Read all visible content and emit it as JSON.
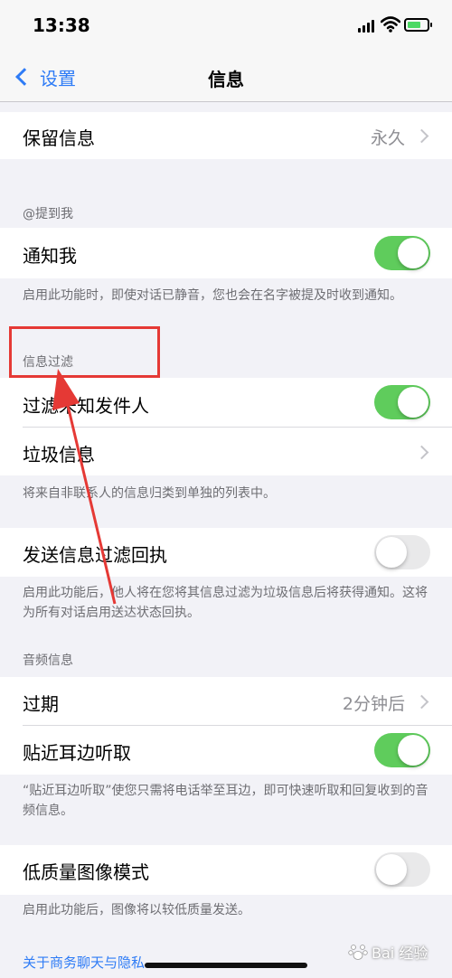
{
  "status_bar": {
    "time": "13:38"
  },
  "nav": {
    "back_label": "设置",
    "title": "信息"
  },
  "keep_messages": {
    "label": "保留信息",
    "value": "永久"
  },
  "mentions": {
    "header": "@提到我",
    "notify_label": "通知我",
    "notify_on": true,
    "footer": "启用此功能时，即使对话已静音，您也会在名字被提及时收到通知。"
  },
  "filtering": {
    "header": "信息过滤",
    "filter_unknown_label": "过滤未知发件人",
    "filter_unknown_on": true,
    "junk_label": "垃圾信息",
    "footer": "将来自非联系人的信息归类到单独的列表中。"
  },
  "filter_receipts": {
    "label": "发送信息过滤回执",
    "on": false,
    "footer": "启用此功能后，他人将在您将其信息过滤为垃圾信息后将获得通知。这将为所有对话启用送达状态回执。"
  },
  "audio": {
    "header": "音频信息",
    "expire_label": "过期",
    "expire_value": "2分钟后",
    "raise_label": "贴近耳边听取",
    "raise_on": true,
    "footer": "“贴近耳边听取”使您只需将电话举至耳边，即可快速听取和回复收到的音频信息。"
  },
  "low_quality": {
    "label": "低质量图像模式",
    "on": false,
    "footer": "启用此功能后，图像将以较低质量发送。"
  },
  "business_link": "关于商务聊天与隐私",
  "watermark": "Bai 经验",
  "colors": {
    "accent": "#2f7cf6",
    "toggle_on": "#5fcc5c",
    "annotation": "#e53935"
  }
}
